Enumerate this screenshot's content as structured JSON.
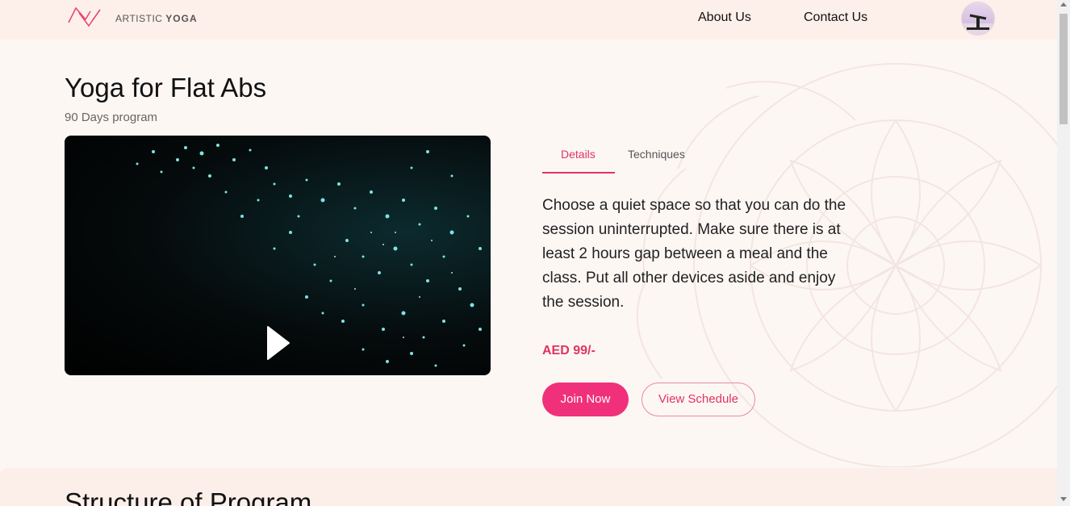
{
  "header": {
    "logo_light": "ARTISTIC",
    "logo_bold": "YOGA",
    "nav": [
      {
        "label": "About Us"
      },
      {
        "label": "Contact Us"
      }
    ]
  },
  "program": {
    "title": "Yoga for Flat Abs",
    "subtitle": "90 Days program"
  },
  "tabs": [
    {
      "label": "Details",
      "active": true
    },
    {
      "label": "Techniques",
      "active": false
    }
  ],
  "details": {
    "description": "Choose a quiet space so that you can do the session uninterrupted. Make sure there is at least 2 hours gap between a meal and the class. Put all other devices aside and enjoy the session.",
    "price": "AED 99/-"
  },
  "actions": {
    "join_label": "Join Now",
    "schedule_label": "View Schedule"
  },
  "structure": {
    "title": "Structure of Program"
  },
  "colors": {
    "accent": "#e0345f",
    "button": "#f0307a",
    "background": "#fdf7f4",
    "header": "#fdf0ea"
  },
  "icons": {
    "video_play": "play-icon",
    "logo": "logo-mark-icon",
    "avatar": "user-avatar-icon"
  }
}
